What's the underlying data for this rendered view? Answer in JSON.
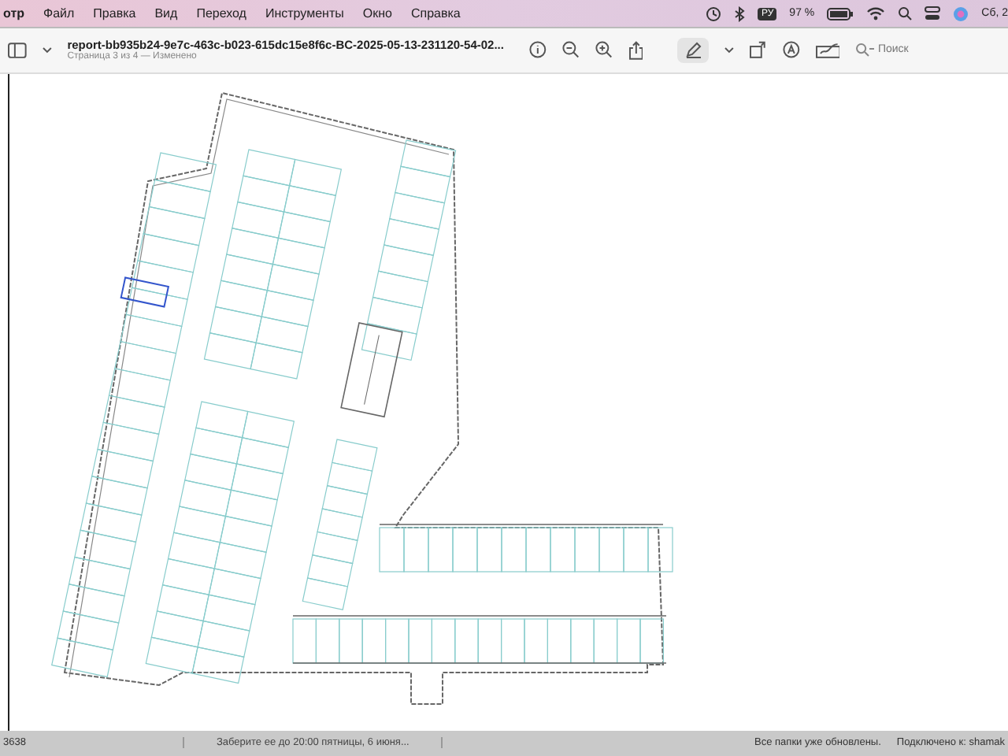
{
  "menu_bar": {
    "app_menu": "отр",
    "items": [
      "Файл",
      "Правка",
      "Вид",
      "Переход",
      "Инструменты",
      "Окно",
      "Справка"
    ],
    "input_source": "РУ",
    "battery_percent": "97 %",
    "clock": "Сб, 2"
  },
  "toolbar": {
    "title": "report-bb935b24-9e7c-463c-b023-615dc15e8f6c-BC-2025-05-13-231120-54-02...",
    "subtitle": "Страница 3 из 4 — Изменено",
    "search": {
      "placeholder": "Поиск"
    }
  },
  "bottom_strip": {
    "left_text": "3638",
    "notification": "Заберите ее до 20:00 пятницы, 6 июня...",
    "status_1": "Все папки уже обновлены.",
    "status_2": "Подключено к: shamak"
  }
}
